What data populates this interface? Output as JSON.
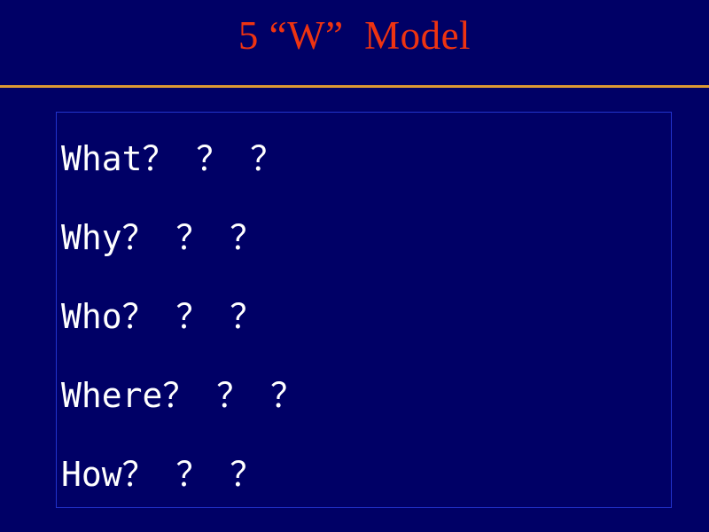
{
  "slide": {
    "title": "5 “W”  Model",
    "background_color": "#000066",
    "title_color": "#ee3311",
    "rule_color": "#dd9933",
    "box_border_color": "#2233cc",
    "body_text_color": "#ffffff",
    "items": [
      {
        "label": "What？ ？ ？"
      },
      {
        "label": "Why？ ？ ？"
      },
      {
        "label": "Who？ ？ ？"
      },
      {
        "label": "Where？ ？ ？"
      },
      {
        "label": "How？ ？ ？"
      }
    ]
  }
}
